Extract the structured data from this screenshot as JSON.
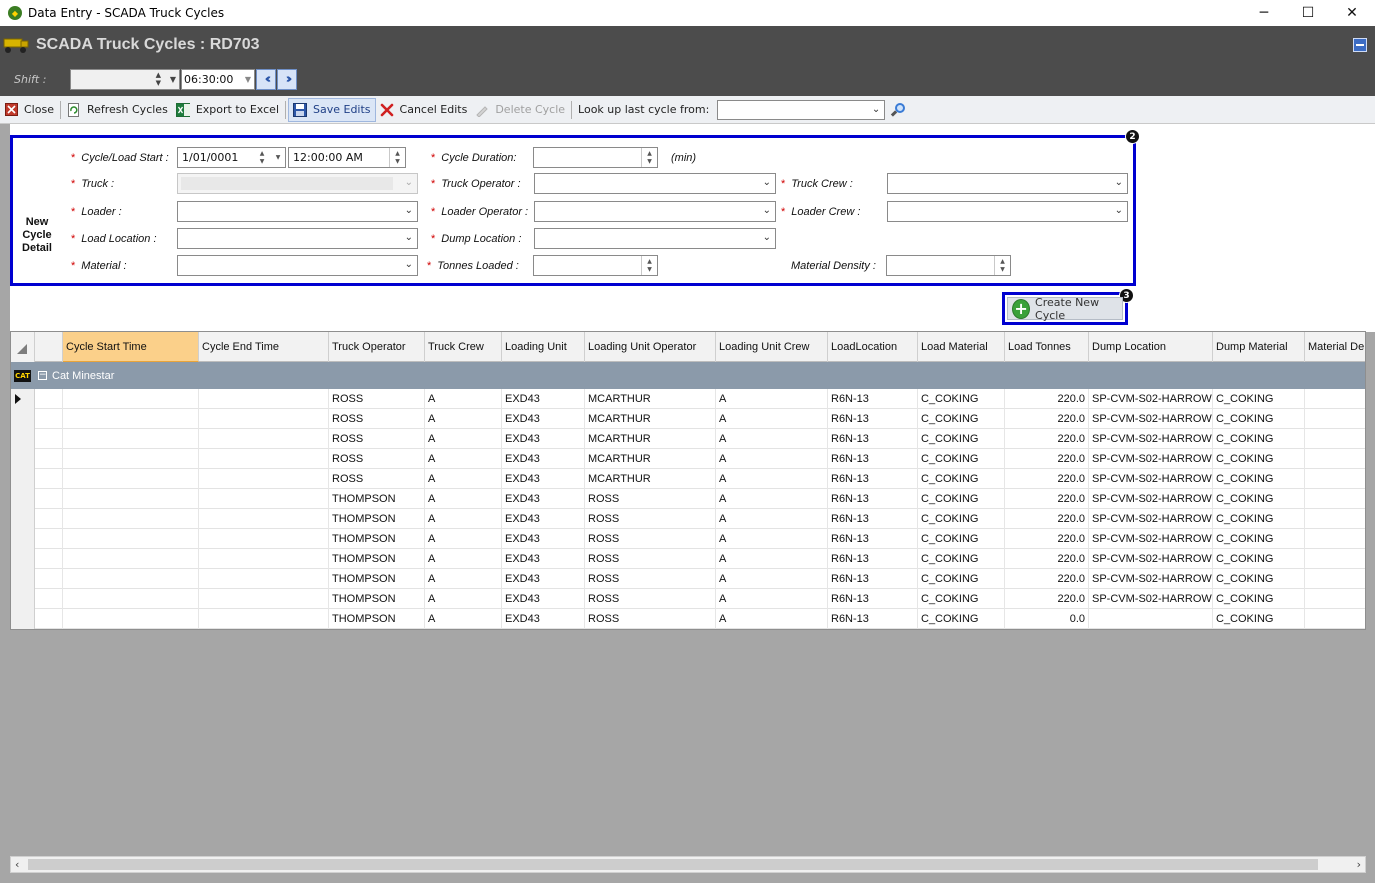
{
  "window": {
    "title": "Data Entry - SCADA Truck Cycles",
    "minimize": "─",
    "maximize": "☐",
    "close": "✕"
  },
  "header": {
    "title": "SCADA Truck Cycles : RD703"
  },
  "shift": {
    "label": "Shift :",
    "date_value": "",
    "time_value": "06:30:00"
  },
  "toolbar": {
    "close_label": "Close",
    "refresh_label": "Refresh Cycles",
    "export_label": "Export to Excel",
    "save_label": "Save Edits",
    "cancel_label": "Cancel Edits",
    "delete_label": "Delete Cycle",
    "lookup_label": "Look up last cycle from:",
    "lookup_value": ""
  },
  "form": {
    "section_label": "New Cycle Detail",
    "badge_form": "2",
    "badge_create": "3",
    "required_mark": "*",
    "cycle_start_label": "Cycle/Load Start :",
    "cycle_start_date": "1/01/0001",
    "cycle_start_time": "12:00:00 AM",
    "cycle_duration_label": "Cycle Duration:",
    "cycle_duration_unit": "(min)",
    "truck_label": "Truck :",
    "truck_operator_label": "Truck Operator :",
    "truck_crew_label": "Truck Crew :",
    "loader_label": "Loader  :",
    "loader_operator_label": "Loader Operator :",
    "loader_crew_label": "Loader Crew :",
    "load_location_label": "Load Location :",
    "dump_location_label": "Dump Location :",
    "material_label": "Material :",
    "tonnes_loaded_label": "Tonnes Loaded :",
    "material_density_label": "Material Density :",
    "create_button_label": "Create New Cycle"
  },
  "grid": {
    "columns": [
      "Cycle Start Time",
      "Cycle End Time",
      "Truck Operator",
      "Truck Crew",
      "Loading Unit",
      "Loading Unit Operator",
      "Loading Unit Crew",
      "LoadLocation",
      "Load Material",
      "Load Tonnes",
      "Dump Location",
      "Dump Material",
      "Material De"
    ],
    "group_label": "Cat Minestar",
    "group_icon_text": "CAT",
    "rows": [
      [
        "",
        "",
        "ROSS",
        "A",
        "EXD43",
        "MCARTHUR",
        "A",
        "R6N-13",
        "C_COKING",
        "220.0",
        "SP-CVM-S02-HARROW",
        "C_COKING",
        ""
      ],
      [
        "",
        "",
        "ROSS",
        "A",
        "EXD43",
        "MCARTHUR",
        "A",
        "R6N-13",
        "C_COKING",
        "220.0",
        "SP-CVM-S02-HARROW",
        "C_COKING",
        ""
      ],
      [
        "",
        "",
        "ROSS",
        "A",
        "EXD43",
        "MCARTHUR",
        "A",
        "R6N-13",
        "C_COKING",
        "220.0",
        "SP-CVM-S02-HARROW",
        "C_COKING",
        ""
      ],
      [
        "",
        "",
        "ROSS",
        "A",
        "EXD43",
        "MCARTHUR",
        "A",
        "R6N-13",
        "C_COKING",
        "220.0",
        "SP-CVM-S02-HARROW",
        "C_COKING",
        ""
      ],
      [
        "",
        "",
        "ROSS",
        "A",
        "EXD43",
        "MCARTHUR",
        "A",
        "R6N-13",
        "C_COKING",
        "220.0",
        "SP-CVM-S02-HARROW",
        "C_COKING",
        ""
      ],
      [
        "",
        "",
        "THOMPSON",
        "A",
        "EXD43",
        "ROSS",
        "A",
        "R6N-13",
        "C_COKING",
        "220.0",
        "SP-CVM-S02-HARROW",
        "C_COKING",
        ""
      ],
      [
        "",
        "",
        "THOMPSON",
        "A",
        "EXD43",
        "ROSS",
        "A",
        "R6N-13",
        "C_COKING",
        "220.0",
        "SP-CVM-S02-HARROW",
        "C_COKING",
        ""
      ],
      [
        "",
        "",
        "THOMPSON",
        "A",
        "EXD43",
        "ROSS",
        "A",
        "R6N-13",
        "C_COKING",
        "220.0",
        "SP-CVM-S02-HARROW",
        "C_COKING",
        ""
      ],
      [
        "",
        "",
        "THOMPSON",
        "A",
        "EXD43",
        "ROSS",
        "A",
        "R6N-13",
        "C_COKING",
        "220.0",
        "SP-CVM-S02-HARROW",
        "C_COKING",
        ""
      ],
      [
        "",
        "",
        "THOMPSON",
        "A",
        "EXD43",
        "ROSS",
        "A",
        "R6N-13",
        "C_COKING",
        "220.0",
        "SP-CVM-S02-HARROW",
        "C_COKING",
        ""
      ],
      [
        "",
        "",
        "THOMPSON",
        "A",
        "EXD43",
        "ROSS",
        "A",
        "R6N-13",
        "C_COKING",
        "220.0",
        "SP-CVM-S02-HARROW",
        "C_COKING",
        ""
      ],
      [
        "",
        "",
        "THOMPSON",
        "A",
        "EXD43",
        "ROSS",
        "A",
        "R6N-13",
        "C_COKING",
        "0.0",
        "",
        "C_COKING",
        ""
      ]
    ]
  },
  "colors": {
    "header_bg": "#4c4c4c",
    "highlight_border": "#0000d0",
    "sorted_column": "#fbd08a",
    "group_row": "#8b9aaa",
    "required": "#d00000"
  }
}
